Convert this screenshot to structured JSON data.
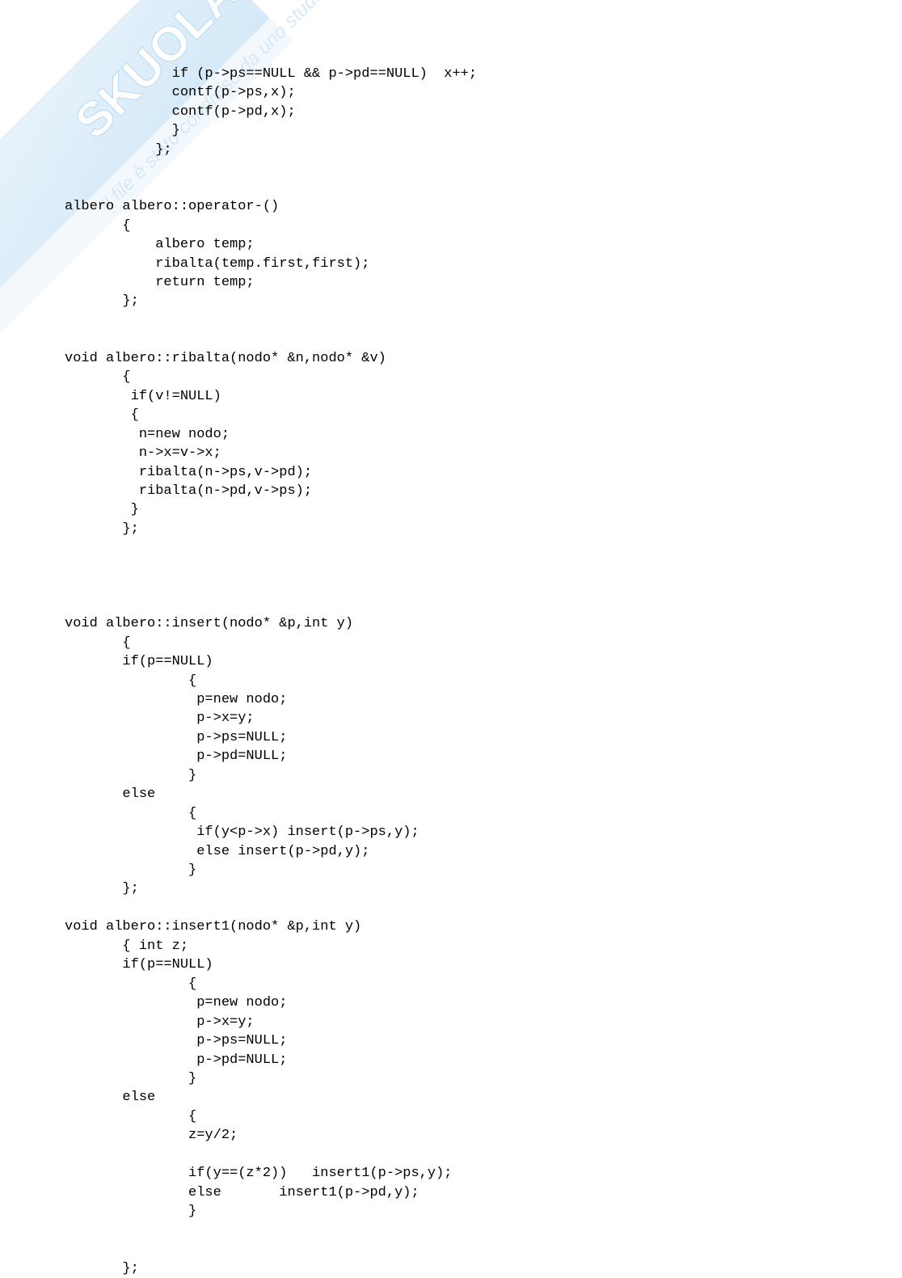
{
  "code_lines": [
    "             if (p->ps==NULL && p->pd==NULL)  x++;",
    "             contf(p->ps,x);",
    "             contf(p->pd,x);",
    "             }",
    "           };",
    "",
    "",
    "albero albero::operator-()",
    "       {",
    "           albero temp;",
    "           ribalta(temp.first,first);",
    "           return temp;",
    "       };",
    "",
    "",
    "void albero::ribalta(nodo* &n,nodo* &v)",
    "       {",
    "        if(v!=NULL)",
    "        {",
    "         n=new nodo;",
    "         n->x=v->x;",
    "         ribalta(n->ps,v->pd);",
    "         ribalta(n->pd,v->ps);",
    "        }",
    "       };",
    "",
    "",
    "",
    "",
    "void albero::insert(nodo* &p,int y)",
    "       {",
    "       if(p==NULL)",
    "               {",
    "                p=new nodo;",
    "                p->x=y;",
    "                p->ps=NULL;",
    "                p->pd=NULL;",
    "               }",
    "       else",
    "               {",
    "                if(y<p->x) insert(p->ps,y);",
    "                else insert(p->pd,y);",
    "               }",
    "       };",
    "",
    "void albero::insert1(nodo* &p,int y)",
    "       { int z;",
    "       if(p==NULL)",
    "               {",
    "                p=new nodo;",
    "                p->x=y;",
    "                p->ps=NULL;",
    "                p->pd=NULL;",
    "               }",
    "       else",
    "               {",
    "               z=y/2;",
    "",
    "               if(y==(z*2))   insert1(p->ps,y);",
    "               else       insert1(p->pd,y);",
    "               }",
    "",
    "",
    "       };"
  ],
  "watermark": {
    "brand": "SKUOLA",
    "subtitle": "condiviso da",
    "role": "studente"
  }
}
